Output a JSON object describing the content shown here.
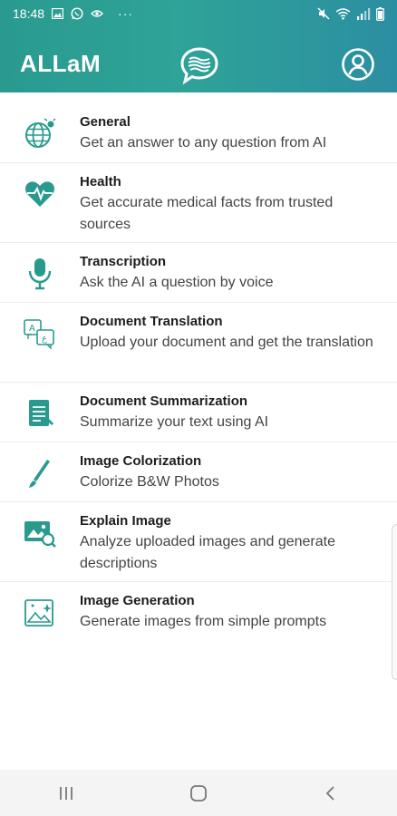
{
  "status_bar": {
    "time": "18:48",
    "ellipsis": "···"
  },
  "header": {
    "title": "ALLaM"
  },
  "colors": {
    "header_start": "#2a9a8f",
    "header_end": "#2c8ea2",
    "icon_teal": "#2a9a8f"
  },
  "services": [
    {
      "icon": "globe-icon",
      "title": "General",
      "description": "Get an answer to any question from AI"
    },
    {
      "icon": "heart-pulse-icon",
      "title": "Health",
      "description": "Get accurate medical facts from trusted sources"
    },
    {
      "icon": "microphone-icon",
      "title": "Transcription",
      "description": "Ask the AI a question by voice"
    },
    {
      "icon": "translate-icon",
      "title": "Document Translation",
      "description": "Upload your document and get the translation"
    },
    {
      "icon": "document-icon",
      "title": "Document Summarization",
      "description": "Summarize your text using AI"
    },
    {
      "icon": "brush-icon",
      "title": "Image Colorization",
      "description": "Colorize B&W Photos"
    },
    {
      "icon": "image-search-icon",
      "title": "Explain Image",
      "description": "Analyze uploaded images and generate descriptions"
    },
    {
      "icon": "image-sparkle-icon",
      "title": "Image Generation",
      "description": "Generate images from simple prompts"
    }
  ],
  "navbar": {
    "recents": "recent-apps-icon",
    "home": "home-icon",
    "back": "back-icon"
  }
}
